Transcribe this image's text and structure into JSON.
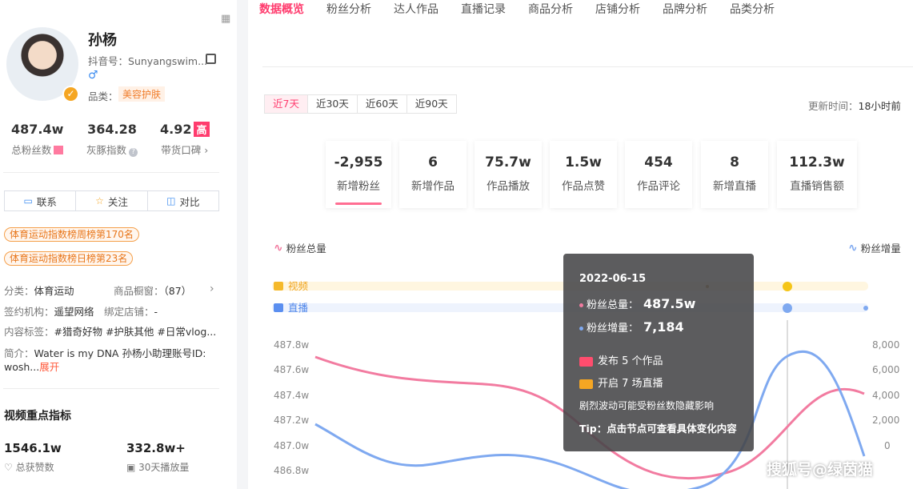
{
  "profile": {
    "name": "孙杨",
    "douyin_label": "抖音号：",
    "douyin_id": "Sunyangswim...",
    "gender_icon": "male-icon",
    "category_label": "品类：",
    "category_tag": "美容护肤",
    "stats": [
      {
        "value": "487.4w",
        "label": "总粉丝数"
      },
      {
        "value": "364.28",
        "label": "灰豚指数"
      },
      {
        "value": "4.92",
        "badge": "高",
        "label": "带货口碑"
      }
    ],
    "actions": [
      {
        "label": "联系",
        "icon": "chat-icon"
      },
      {
        "label": "关注",
        "icon": "star-icon"
      },
      {
        "label": "对比",
        "icon": "compare-icon"
      }
    ],
    "ranks": [
      "体育运动指数榜周榜第170名",
      "体育运动指数榜日榜第23名"
    ],
    "info": {
      "category_label": "分类：",
      "category": "体育运动",
      "showcase_label": "商品橱窗：",
      "showcase": "（87）",
      "agency_label": "签约机构：",
      "agency": "遥望网络",
      "shop_label": "绑定店铺：",
      "shop": "-",
      "tags_label": "内容标签：",
      "tags": "#猎奇好物 #护肤其他 #日常vlog...",
      "intro_label": "简介：",
      "intro_line1": "Water is my DNA 孙杨小助理账号ID:",
      "intro_line2": "wosh...",
      "expand": "展开"
    },
    "video_section": {
      "title": "视频重点指标",
      "kpis": [
        {
          "value": "1546.1w",
          "label": "总获赞数",
          "icon": "heart-icon"
        },
        {
          "value": "332.8w+",
          "label": "30天播放量",
          "icon": "play-icon"
        }
      ]
    }
  },
  "tabs": [
    "数据概览",
    "粉丝分析",
    "达人作品",
    "直播记录",
    "商品分析",
    "店铺分析",
    "品牌分析",
    "品类分析"
  ],
  "active_tab": "数据概览",
  "periods": [
    "近7天",
    "近30天",
    "近60天",
    "近90天"
  ],
  "active_period": "近7天",
  "update": {
    "label": "更新时间：",
    "value": "18小时前"
  },
  "cards": [
    {
      "value": "-2,955",
      "label": "新增粉丝",
      "selected": true
    },
    {
      "value": "6",
      "label": "新增作品"
    },
    {
      "value": "75.7w",
      "label": "作品播放"
    },
    {
      "value": "1.5w",
      "label": "作品点赞"
    },
    {
      "value": "454",
      "label": "作品评论"
    },
    {
      "value": "8",
      "label": "新增直播"
    },
    {
      "value": "112.3w",
      "label": "直播销售额"
    }
  ],
  "chart_data": {
    "type": "line",
    "legend_left": "粉丝总量",
    "legend_right": "粉丝增量",
    "event_rows": [
      "视频",
      "直播"
    ],
    "y_left_ticks": [
      "487.8w",
      "487.6w",
      "487.4w",
      "487.2w",
      "487.0w",
      "486.8w"
    ],
    "y_right_ticks": [
      "8,000",
      "6,000",
      "4,000",
      "2,000",
      "0"
    ],
    "series": [
      {
        "name": "粉丝总量",
        "color": "#f27ba0"
      },
      {
        "name": "粉丝增量",
        "color": "#7fa9f0"
      }
    ],
    "tooltip": {
      "date": "2022-06-15",
      "total_label": "粉丝总量：",
      "total_value": "487.5w",
      "increase_label": "粉丝增量：",
      "increase_value": "7,184",
      "works_text": "发布 5 个作品",
      "live_text": "开启 7 场直播",
      "note": "剧烈波动可能受粉丝数隐藏影响",
      "tip": "Tip：点击节点可查看具体变化内容"
    }
  },
  "watermark": "搜狐号@绿茵猫",
  "colors": {
    "accent": "#ff3c6e",
    "orange": "#f5a623",
    "blue": "#3c8cf0"
  }
}
